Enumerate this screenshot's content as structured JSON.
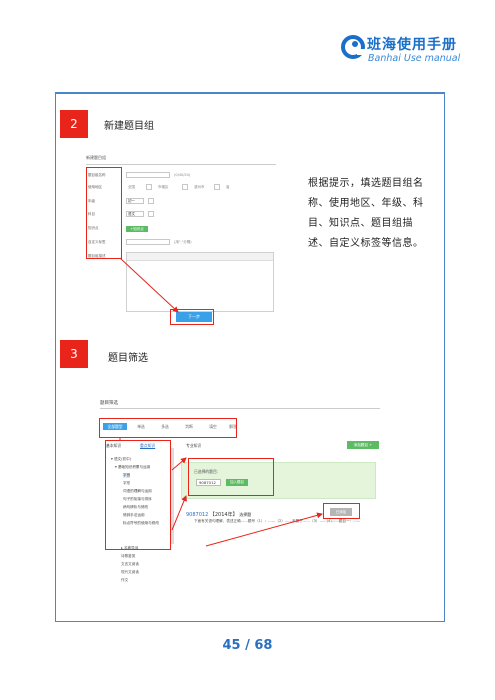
{
  "brand": {
    "title": "班海使用手册",
    "subtitle": "Banhai Use manual",
    "color": "#1a6fc9"
  },
  "steps": [
    {
      "number": "2",
      "title": "新建题目组",
      "description": "根据提示，填选题目组名称、使用地区、年级、科目、知识点、题目组描述、自定义标签等信息。"
    },
    {
      "number": "3",
      "title": "题目筛选"
    }
  ],
  "screenshot_new_group": {
    "heading": "新建题目组",
    "fields": [
      {
        "label": "题目组名称",
        "hint": "(0/40/20)"
      },
      {
        "label": "使用地区",
        "options": [
          "全国",
          "市辖区",
          "滨州市",
          "省"
        ]
      },
      {
        "label": "年级",
        "value": "初一"
      },
      {
        "label": "科目",
        "value": "语文"
      },
      {
        "label": "知识点",
        "button": "+知识点"
      },
      {
        "label": "自定义标签",
        "hint": "(用\",\"分隔)"
      },
      {
        "label": "题目组描述"
      }
    ],
    "submit_label": "下一步"
  },
  "screenshot_filter": {
    "heading": "题目筛选",
    "tabs": [
      "全部题型",
      "单选",
      "多选",
      "判断",
      "填空",
      "解答"
    ],
    "active_tab": "全部题型",
    "subtabs": [
      "基本知识",
      "重点知识",
      "专业知识"
    ],
    "tree": [
      "▾ 语文(初中)",
      "▾ 基础知识积累与运用",
      "  字音",
      "  字形",
      "  词语的理解与运用",
      "  句子的衔接与排序",
      "  病句辨析与修改",
      "  修辞手法运用",
      "  标点符号的使用与修改",
      "▸ 名著导读",
      "  诗歌鉴赏",
      "  文言文阅读",
      "  现代文阅读",
      "  作文"
    ],
    "add_button": "添加题目 +",
    "chosen_label": "已选择的题目：",
    "chosen_value": "9087012",
    "chosen_button": "加入题目",
    "grey_button": "已添加",
    "question": {
      "code": "9087012",
      "tag": "【2014年】",
      "source": "选择题",
      "text": "下面有关语句理解，表述正确……题号（1）：……（2）……不属于……（3）……(4)……题目一：……"
    }
  },
  "page_number": "45 / 68"
}
